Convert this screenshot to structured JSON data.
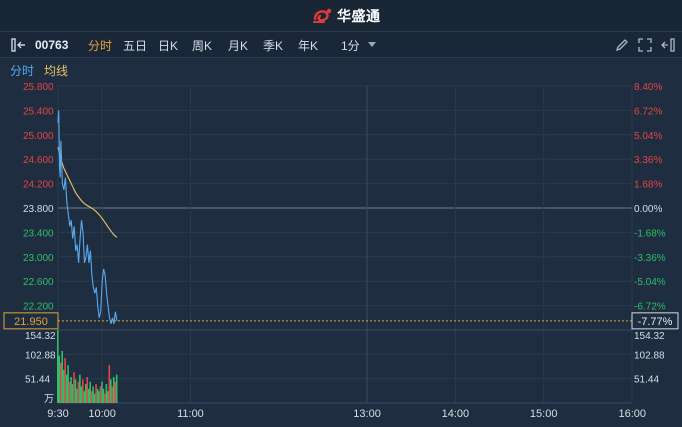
{
  "header": {
    "brand": "华盛通"
  },
  "toolbar": {
    "stock_code": "00763",
    "tabs": [
      "分时",
      "五日",
      "日K",
      "周K",
      "月K",
      "季K",
      "年K"
    ],
    "active_tab": 0,
    "interval": "1分"
  },
  "legend": {
    "time_label": "分时",
    "avg_label": "均线"
  },
  "colors": {
    "price_line": "#5aa9ef",
    "avg_line": "#e8c36a",
    "up": "#e64545",
    "down": "#2fbf6a",
    "active_tab": "#e9a23b",
    "background": "#1e2d3f"
  },
  "chart_data": {
    "type": "line",
    "prev_close": 23.8,
    "price_axis": {
      "min": 21.8,
      "max": 25.8,
      "ticks": [
        "25.800",
        "25.400",
        "25.000",
        "24.600",
        "24.200",
        "23.800",
        "23.400",
        "23.000",
        "22.600",
        "22.200"
      ],
      "tick_values": [
        25.8,
        25.4,
        25.0,
        24.6,
        24.2,
        23.8,
        23.4,
        23.0,
        22.6,
        22.2
      ]
    },
    "pct_axis": {
      "ticks": [
        "8.40%",
        "6.72%",
        "5.04%",
        "3.36%",
        "1.68%",
        "0.00%",
        "-1.68%",
        "-3.36%",
        "-5.04%",
        "-6.72%"
      ]
    },
    "current_price": "21.950",
    "current_pct": "-7.77%",
    "current_price_value": 21.95,
    "volume_axis": {
      "max": 154.32,
      "ticks": [
        "154.32",
        "102.88",
        "51.44"
      ],
      "tick_values": [
        154.32,
        102.88,
        51.44
      ],
      "unit": "万"
    },
    "time_ticks": [
      "9:30",
      "10:00",
      "11:00",
      "13:00",
      "14:00",
      "15:00",
      "16:00"
    ],
    "time_tick_minutes": [
      0,
      30,
      90,
      210,
      270,
      330,
      390
    ],
    "total_minutes": 390,
    "price_series": [
      {
        "t": 0,
        "v": 25.2
      },
      {
        "t": 0.5,
        "v": 25.4
      },
      {
        "t": 1,
        "v": 24.5
      },
      {
        "t": 1.5,
        "v": 24.3
      },
      {
        "t": 2,
        "v": 24.9
      },
      {
        "t": 3,
        "v": 24.2
      },
      {
        "t": 4,
        "v": 24.1
      },
      {
        "t": 5,
        "v": 24.3
      },
      {
        "t": 6,
        "v": 23.9
      },
      {
        "t": 7,
        "v": 23.7
      },
      {
        "t": 8,
        "v": 23.5
      },
      {
        "t": 9,
        "v": 23.6
      },
      {
        "t": 10,
        "v": 23.3
      },
      {
        "t": 11,
        "v": 23.5
      },
      {
        "t": 12,
        "v": 23.1
      },
      {
        "t": 13,
        "v": 23.2
      },
      {
        "t": 14,
        "v": 22.9
      },
      {
        "t": 15,
        "v": 23.3
      },
      {
        "t": 16,
        "v": 23.6
      },
      {
        "t": 17,
        "v": 23.4
      },
      {
        "t": 18,
        "v": 22.9
      },
      {
        "t": 19,
        "v": 23.0
      },
      {
        "t": 20,
        "v": 23.2
      },
      {
        "t": 21,
        "v": 22.9
      },
      {
        "t": 22,
        "v": 23.1
      },
      {
        "t": 23,
        "v": 22.7
      },
      {
        "t": 24,
        "v": 22.5
      },
      {
        "t": 25,
        "v": 22.4
      },
      {
        "t": 26,
        "v": 22.5
      },
      {
        "t": 27,
        "v": 22.2
      },
      {
        "t": 28,
        "v": 22.0
      },
      {
        "t": 29,
        "v": 22.1
      },
      {
        "t": 30,
        "v": 22.6
      },
      {
        "t": 31,
        "v": 22.8
      },
      {
        "t": 32,
        "v": 22.7
      },
      {
        "t": 33,
        "v": 22.4
      },
      {
        "t": 34,
        "v": 22.2
      },
      {
        "t": 35,
        "v": 22.0
      },
      {
        "t": 36,
        "v": 21.9
      },
      {
        "t": 37,
        "v": 22.0
      },
      {
        "t": 38,
        "v": 21.9
      },
      {
        "t": 39,
        "v": 22.1
      },
      {
        "t": 40,
        "v": 21.95
      }
    ],
    "avg_series": [
      {
        "t": 0,
        "v": 24.8
      },
      {
        "t": 2,
        "v": 24.6
      },
      {
        "t": 4,
        "v": 24.45
      },
      {
        "t": 6,
        "v": 24.35
      },
      {
        "t": 8,
        "v": 24.25
      },
      {
        "t": 10,
        "v": 24.15
      },
      {
        "t": 12,
        "v": 24.05
      },
      {
        "t": 14,
        "v": 23.98
      },
      {
        "t": 16,
        "v": 23.92
      },
      {
        "t": 18,
        "v": 23.87
      },
      {
        "t": 20,
        "v": 23.84
      },
      {
        "t": 22,
        "v": 23.81
      },
      {
        "t": 24,
        "v": 23.78
      },
      {
        "t": 26,
        "v": 23.74
      },
      {
        "t": 28,
        "v": 23.69
      },
      {
        "t": 30,
        "v": 23.63
      },
      {
        "t": 32,
        "v": 23.56
      },
      {
        "t": 34,
        "v": 23.49
      },
      {
        "t": 36,
        "v": 23.42
      },
      {
        "t": 38,
        "v": 23.36
      },
      {
        "t": 40,
        "v": 23.32
      }
    ],
    "volume_bars": [
      {
        "t": 0,
        "v": 154,
        "up": false
      },
      {
        "t": 1,
        "v": 100,
        "up": false
      },
      {
        "t": 2,
        "v": 85,
        "up": true
      },
      {
        "t": 3,
        "v": 110,
        "up": false
      },
      {
        "t": 4,
        "v": 70,
        "up": false
      },
      {
        "t": 5,
        "v": 95,
        "up": true
      },
      {
        "t": 6,
        "v": 60,
        "up": false
      },
      {
        "t": 7,
        "v": 80,
        "up": false
      },
      {
        "t": 8,
        "v": 45,
        "up": true
      },
      {
        "t": 9,
        "v": 55,
        "up": false
      },
      {
        "t": 10,
        "v": 40,
        "up": false
      },
      {
        "t": 11,
        "v": 65,
        "up": true
      },
      {
        "t": 12,
        "v": 50,
        "up": false
      },
      {
        "t": 13,
        "v": 30,
        "up": false
      },
      {
        "t": 14,
        "v": 45,
        "up": true
      },
      {
        "t": 15,
        "v": 60,
        "up": false
      },
      {
        "t": 16,
        "v": 35,
        "up": false
      },
      {
        "t": 17,
        "v": 50,
        "up": true
      },
      {
        "t": 18,
        "v": 25,
        "up": false
      },
      {
        "t": 19,
        "v": 40,
        "up": false
      },
      {
        "t": 20,
        "v": 55,
        "up": true
      },
      {
        "t": 21,
        "v": 30,
        "up": false
      },
      {
        "t": 22,
        "v": 45,
        "up": false
      },
      {
        "t": 23,
        "v": 25,
        "up": true
      },
      {
        "t": 24,
        "v": 35,
        "up": false
      },
      {
        "t": 25,
        "v": 20,
        "up": false
      },
      {
        "t": 26,
        "v": 40,
        "up": true
      },
      {
        "t": 27,
        "v": 30,
        "up": false
      },
      {
        "t": 28,
        "v": 25,
        "up": false
      },
      {
        "t": 29,
        "v": 35,
        "up": true
      },
      {
        "t": 30,
        "v": 45,
        "up": false
      },
      {
        "t": 31,
        "v": 30,
        "up": false
      },
      {
        "t": 32,
        "v": 20,
        "up": true
      },
      {
        "t": 33,
        "v": 40,
        "up": false
      },
      {
        "t": 34,
        "v": 25,
        "up": false
      },
      {
        "t": 35,
        "v": 80,
        "up": true
      },
      {
        "t": 36,
        "v": 50,
        "up": false
      },
      {
        "t": 37,
        "v": 35,
        "up": true
      },
      {
        "t": 38,
        "v": 55,
        "up": false
      },
      {
        "t": 39,
        "v": 45,
        "up": true
      },
      {
        "t": 40,
        "v": 60,
        "up": false
      }
    ]
  }
}
